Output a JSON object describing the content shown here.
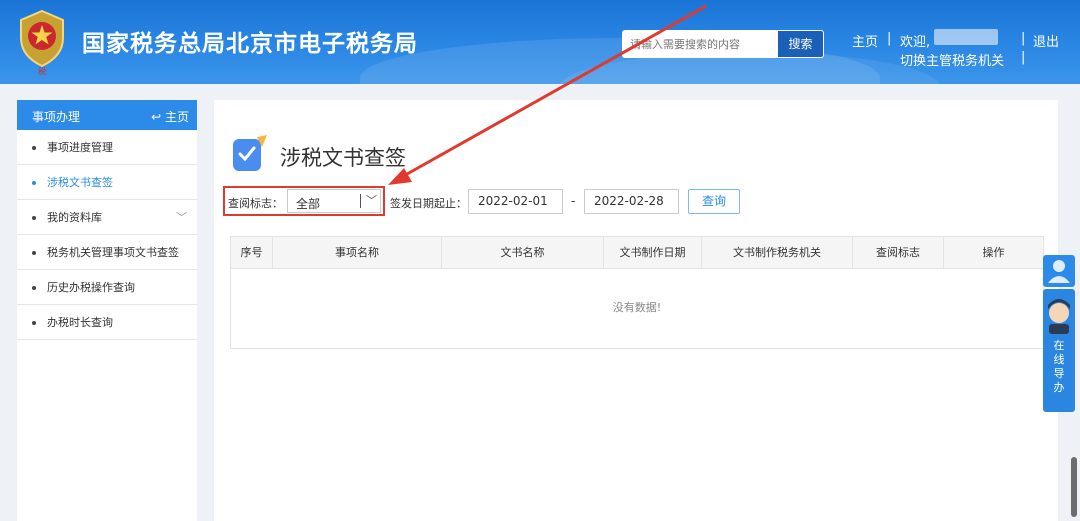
{
  "header": {
    "site_title": "国家税务总局北京市电子税务局",
    "search_placeholder": "请输入需要搜索的内容",
    "search_button": "搜索",
    "home_link": "主页",
    "separator": "|",
    "welcome": "欢迎,",
    "logout": "退出",
    "switch_org": "切换主管税务机关"
  },
  "sidebar": {
    "title": "事项办理",
    "home": "主页",
    "items": [
      {
        "label": "事项进度管理"
      },
      {
        "label": "涉税文书查签"
      },
      {
        "label": "我的资料库"
      },
      {
        "label": "税务机关管理事项文书查签"
      },
      {
        "label": "历史办税操作查询"
      },
      {
        "label": "办税时长查询"
      }
    ]
  },
  "main": {
    "page_title": "涉税文书查签",
    "filter": {
      "status_label": "查阅标志：",
      "status_value": "全部",
      "date_label": "签发日期起止：",
      "date_from": "2022-02-01",
      "date_sep": "-",
      "date_to": "2022-02-28",
      "query_button": "查询"
    },
    "table": {
      "columns": [
        "序号",
        "事项名称",
        "文书名称",
        "文书制作日期",
        "文书制作税务机关",
        "查阅标志",
        "操作"
      ],
      "empty_text": "没有数据!"
    }
  },
  "float_widget": {
    "guide_chars": [
      "在",
      "线",
      "导",
      "办"
    ]
  },
  "colors": {
    "header_blue": "#1a74d6",
    "accent": "#2b8ce6",
    "annotation_red": "#e03a2e"
  }
}
